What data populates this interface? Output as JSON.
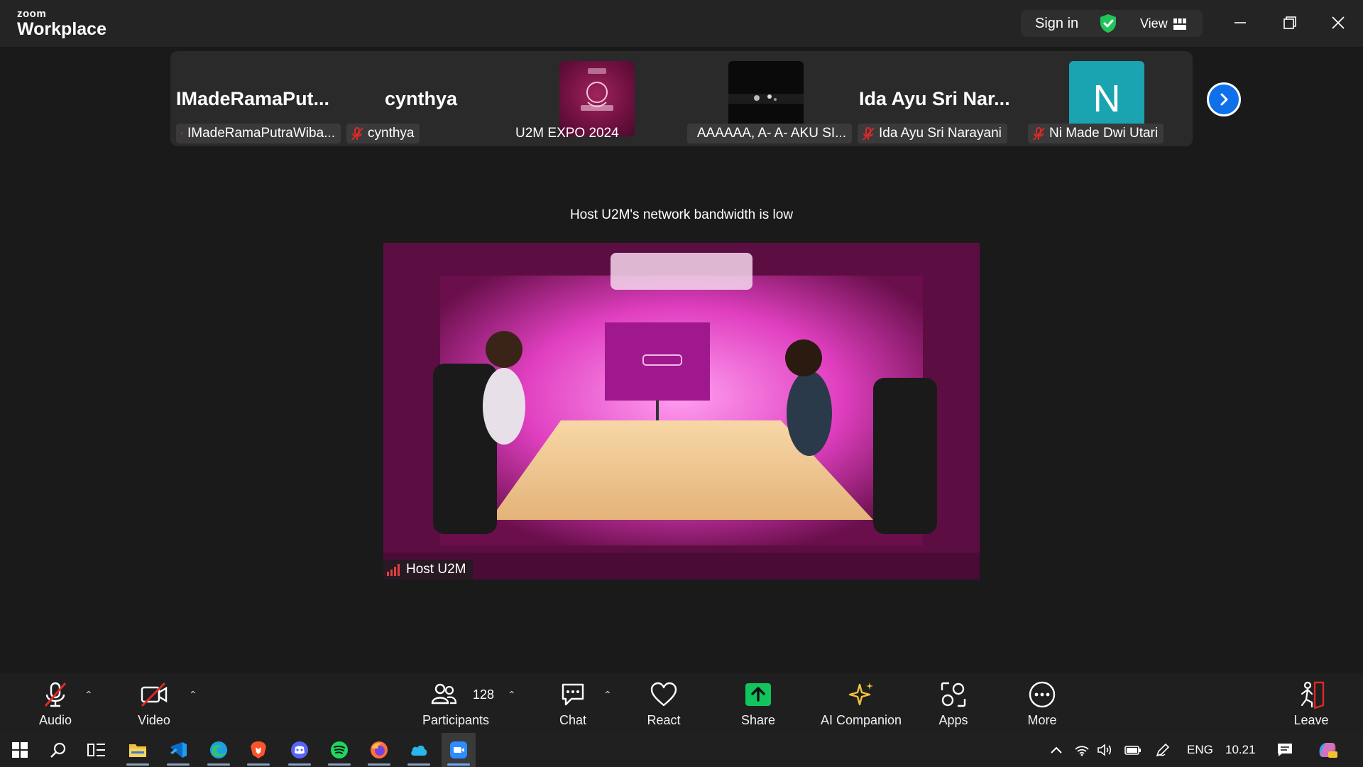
{
  "app": {
    "brand_top": "zoom",
    "brand_bottom": "Workplace"
  },
  "titlebar": {
    "sign_in": "Sign in",
    "view": "View"
  },
  "participants_strip": [
    {
      "big_name": "IMadeRamaPut...",
      "label": "IMadeRamaPutraWiba...",
      "muted": true
    },
    {
      "big_name": "cynthya",
      "label": "cynthya",
      "muted": true
    },
    {
      "big_name": "",
      "label": "U2M EXPO 2024",
      "muted": false
    },
    {
      "big_name": "",
      "label": "AAAAAA, A- A- AKU SI...",
      "muted": true
    },
    {
      "big_name": "Ida Ayu Sri Nar...",
      "label": "Ida Ayu Sri Narayani",
      "muted": true
    },
    {
      "big_name": "",
      "label": "Ni Made Dwi Utari",
      "muted": true,
      "avatar_letter": "N"
    }
  ],
  "stage": {
    "notice": "Host U2M's network bandwidth is low",
    "host_label": "Host U2M"
  },
  "toolbar": {
    "audio": "Audio",
    "video": "Video",
    "participants": "Participants",
    "participants_count": "128",
    "chat": "Chat",
    "react": "React",
    "share": "Share",
    "ai_companion": "AI Companion",
    "apps": "Apps",
    "more": "More",
    "leave": "Leave"
  },
  "taskbar": {
    "lang": "ENG",
    "time": "10.21"
  },
  "colors": {
    "accent_blue": "#0e71eb",
    "share_green": "#11c45b",
    "mute_red": "#e02828",
    "avatar_teal": "#1aa3b0"
  }
}
